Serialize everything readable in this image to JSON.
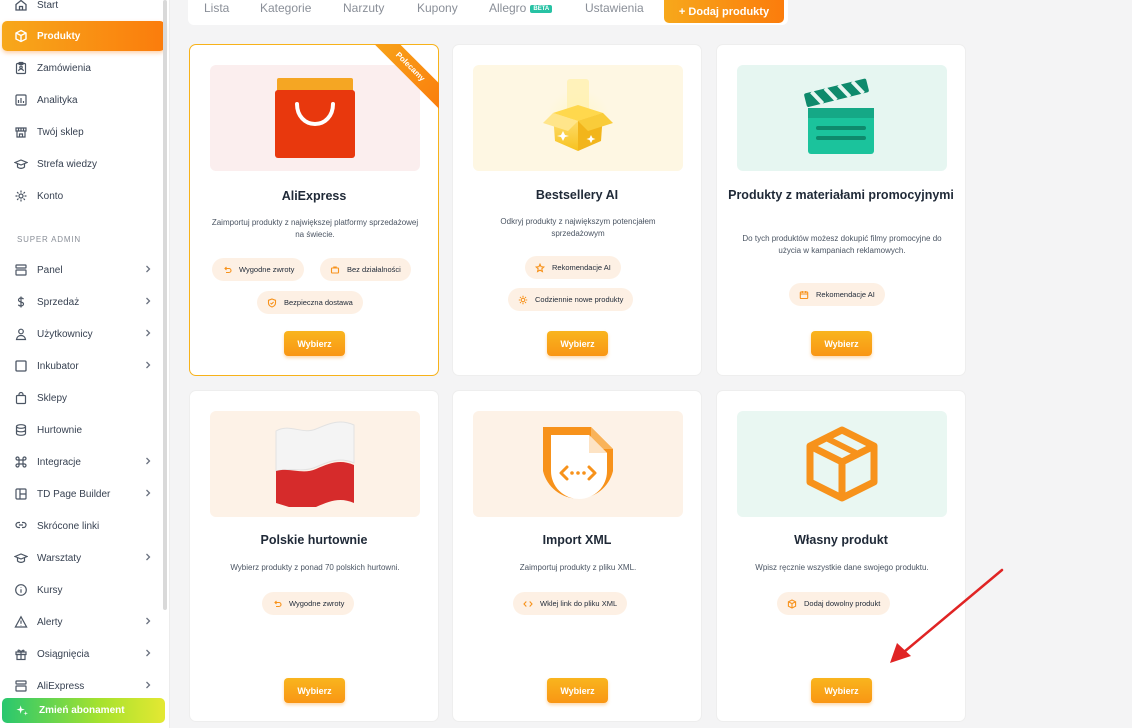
{
  "sidebar": {
    "items": [
      {
        "label": "Start",
        "icon": "home-icon"
      },
      {
        "label": "Produkty",
        "icon": "cube-icon",
        "active": true
      },
      {
        "label": "Zamówienia",
        "icon": "clipboard-icon"
      },
      {
        "label": "Analityka",
        "icon": "chart-icon"
      },
      {
        "label": "Twój sklep",
        "icon": "store-icon"
      },
      {
        "label": "Strefa wiedzy",
        "icon": "graduation-cap-icon"
      },
      {
        "label": "Konto",
        "icon": "gear-icon"
      }
    ],
    "section_label": "SUPER ADMIN",
    "admin_items": [
      {
        "label": "Panel",
        "icon": "panel-icon"
      },
      {
        "label": "Sprzedaż",
        "icon": "dollar-icon"
      },
      {
        "label": "Użytkownicy",
        "icon": "user-icon"
      },
      {
        "label": "Inkubator",
        "icon": "square-icon"
      },
      {
        "label": "Sklepy",
        "icon": "bag-icon"
      },
      {
        "label": "Hurtownie",
        "icon": "database-icon"
      },
      {
        "label": "Integracje",
        "icon": "command-icon"
      },
      {
        "label": "TD Page Builder",
        "icon": "layout-icon"
      },
      {
        "label": "Skrócone linki",
        "icon": "link-icon"
      },
      {
        "label": "Warsztaty",
        "icon": "graduation-cap-icon"
      },
      {
        "label": "Kursy",
        "icon": "info-icon"
      },
      {
        "label": "Alerty",
        "icon": "warning-icon"
      },
      {
        "label": "Osiągnięcia",
        "icon": "gift-icon"
      },
      {
        "label": "AliExpress",
        "icon": "panel-icon"
      }
    ],
    "upgrade_label": "Zmień abonament"
  },
  "tabs": {
    "items": [
      "Lista",
      "Kategorie",
      "Narzuty",
      "Kupony",
      "Allegro",
      "Ustawienia"
    ],
    "beta_badge": "BETA",
    "add_button": "+ Dodaj produkty"
  },
  "cards": [
    {
      "title": "AliExpress",
      "description": "Zaimportuj produkty z największej platformy sprzedażowej na świecie.",
      "ribbon": "Polecamy",
      "chips": [
        {
          "label": "Wygodne zwroty",
          "icon": "return-icon"
        },
        {
          "label": "Bez działalności",
          "icon": "briefcase-icon"
        },
        {
          "label": "Bezpieczna dostawa",
          "icon": "shield-icon"
        }
      ],
      "button": "Wybierz"
    },
    {
      "title": "Bestsellery AI",
      "description": "Odkryj produkty z największym potencjałem sprzedażowym",
      "chips": [
        {
          "label": "Rekomendacje AI",
          "icon": "star-icon"
        },
        {
          "label": "Codziennie nowe produkty",
          "icon": "sun-icon"
        }
      ],
      "button": "Wybierz"
    },
    {
      "title": "Produkty z materiałami promocyjnymi",
      "description": "Do tych produktów możesz dokupić filmy promocyjne do użycia w kampaniach reklamowych.",
      "chips": [
        {
          "label": "Rekomendacje AI",
          "icon": "calendar-icon"
        }
      ],
      "button": "Wybierz"
    },
    {
      "title": "Polskie hurtownie",
      "description": "Wybierz produkty z ponad 70 polskich hurtowni.",
      "chips": [
        {
          "label": "Wygodne zwroty",
          "icon": "return-icon"
        }
      ],
      "button": "Wybierz"
    },
    {
      "title": "Import XML",
      "description": "Zaimportuj produkty z pliku XML.",
      "chips": [
        {
          "label": "Wklej link do pliku XML",
          "icon": "code-icon"
        }
      ],
      "button": "Wybierz"
    },
    {
      "title": "Własny produkt",
      "description": "Wpisz ręcznie wszystkie dane swojego produktu.",
      "chips": [
        {
          "label": "Dodaj dowolny produkt",
          "icon": "box-icon"
        }
      ],
      "button": "Wybierz"
    }
  ],
  "colors": {
    "accent": "#fb8c0e",
    "accent_light": "#f7a81b",
    "upgrade_start": "#28c76f",
    "upgrade_end": "#e4e832",
    "annotation_arrow": "#e02424"
  }
}
